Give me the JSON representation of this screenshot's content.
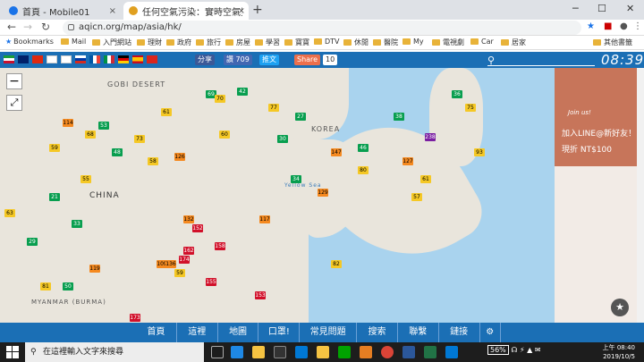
{
  "browser": {
    "tabs": [
      {
        "label": "首頁 - Mobile01"
      },
      {
        "label": "任何空氣污染：實時空氣質量指數"
      }
    ],
    "url": "aqicn.org/map/asia/hk/",
    "bookmarks": [
      "Bookmarks",
      "Mail",
      "入門網站",
      "理財",
      "政府",
      "旅行",
      "房屋",
      "學習",
      "寶寶",
      "DTV",
      "休閒",
      "醫院",
      "My",
      "電視劇",
      "Car",
      "居家",
      "其他書籤"
    ]
  },
  "header": {
    "share_fb": "分享",
    "like": "讚 709",
    "tweet": "推文",
    "share": "Share",
    "share_count": "10",
    "time": "08:39"
  },
  "map": {
    "labels": {
      "gobi": "GOBI DESERT",
      "china": "CHINA",
      "korea": "KOREA",
      "yellow_sea": "Yellow Sea",
      "myanmar": "MYANMAR (BURMA)"
    },
    "markers": [
      {
        "v": "69",
        "c": "g"
      },
      {
        "v": "70",
        "c": "y"
      },
      {
        "v": "68",
        "c": "y"
      },
      {
        "v": "53",
        "c": "g"
      },
      {
        "v": "77",
        "c": "y"
      },
      {
        "v": "114",
        "c": "o"
      },
      {
        "v": "59",
        "c": "y"
      },
      {
        "v": "61",
        "c": "y"
      },
      {
        "v": "42",
        "c": "g"
      },
      {
        "v": "27",
        "c": "g"
      },
      {
        "v": "73",
        "c": "y"
      },
      {
        "v": "48",
        "c": "g"
      },
      {
        "v": "126",
        "c": "o"
      },
      {
        "v": "55",
        "c": "y"
      },
      {
        "v": "21",
        "c": "g"
      },
      {
        "v": "63",
        "c": "y"
      },
      {
        "v": "152",
        "c": "r"
      },
      {
        "v": "158",
        "c": "r"
      },
      {
        "v": "109",
        "c": "o"
      },
      {
        "v": "132",
        "c": "o"
      },
      {
        "v": "162",
        "c": "r"
      },
      {
        "v": "174",
        "c": "r"
      },
      {
        "v": "136",
        "c": "o"
      },
      {
        "v": "155",
        "c": "r"
      },
      {
        "v": "153",
        "c": "r"
      },
      {
        "v": "50",
        "c": "g"
      },
      {
        "v": "81",
        "c": "y"
      },
      {
        "v": "82",
        "c": "y"
      },
      {
        "v": "173",
        "c": "r"
      },
      {
        "v": "59",
        "c": "y"
      },
      {
        "v": "34",
        "c": "g"
      },
      {
        "v": "58",
        "c": "y"
      },
      {
        "v": "60",
        "c": "y"
      },
      {
        "v": "30",
        "c": "g"
      },
      {
        "v": "46",
        "c": "g"
      },
      {
        "v": "129",
        "c": "o"
      },
      {
        "v": "147",
        "c": "o"
      },
      {
        "v": "127",
        "c": "o"
      },
      {
        "v": "80",
        "c": "y"
      },
      {
        "v": "119",
        "c": "o"
      },
      {
        "v": "238",
        "c": "p"
      },
      {
        "v": "93",
        "c": "y"
      },
      {
        "v": "36",
        "c": "g"
      },
      {
        "v": "75",
        "c": "y"
      },
      {
        "v": "38",
        "c": "g"
      },
      {
        "v": "61",
        "c": "y"
      },
      {
        "v": "57",
        "c": "y"
      },
      {
        "v": "117",
        "c": "o"
      },
      {
        "v": "33",
        "c": "g"
      },
      {
        "v": "29",
        "c": "g"
      }
    ]
  },
  "ad": {
    "script": "Join us!",
    "line1": "加入LINE@新好友！",
    "line2": "現折 NT$100"
  },
  "bottom_nav": [
    "首頁",
    "這裡",
    "地圖",
    "口罩!",
    "常見問題",
    "搜索",
    "聯繫",
    "鏈接"
  ],
  "taskbar": {
    "search": "在這裡輸入文字來搜尋",
    "battery": "56%",
    "time": "上午 08:40",
    "date": "2019/10/5"
  }
}
